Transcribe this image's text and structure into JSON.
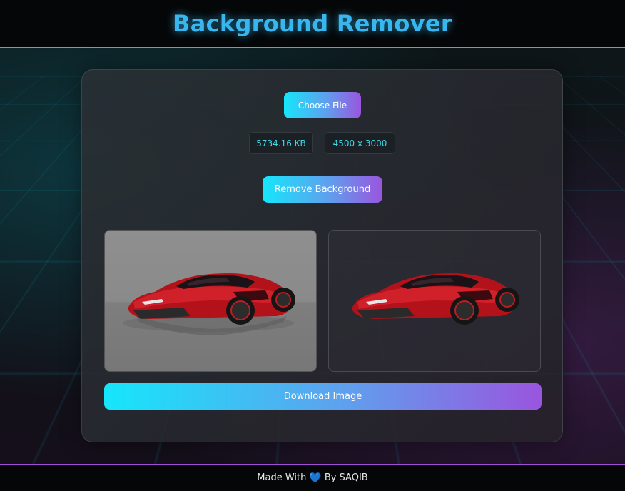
{
  "header": {
    "title": "Background Remover"
  },
  "uploader": {
    "choose_label": "Choose File"
  },
  "file_info": {
    "size": "5734.16 KB",
    "dimensions": "4500 x 3000"
  },
  "actions": {
    "remove_label": "Remove Background",
    "download_label": "Download Image"
  },
  "footer": {
    "prefix": "Made With",
    "heart": "💙",
    "suffix": "By SAQIB"
  },
  "colors": {
    "accent_start": "#16e6fb",
    "accent_end": "#9a55de",
    "title": "#38b6f0"
  }
}
